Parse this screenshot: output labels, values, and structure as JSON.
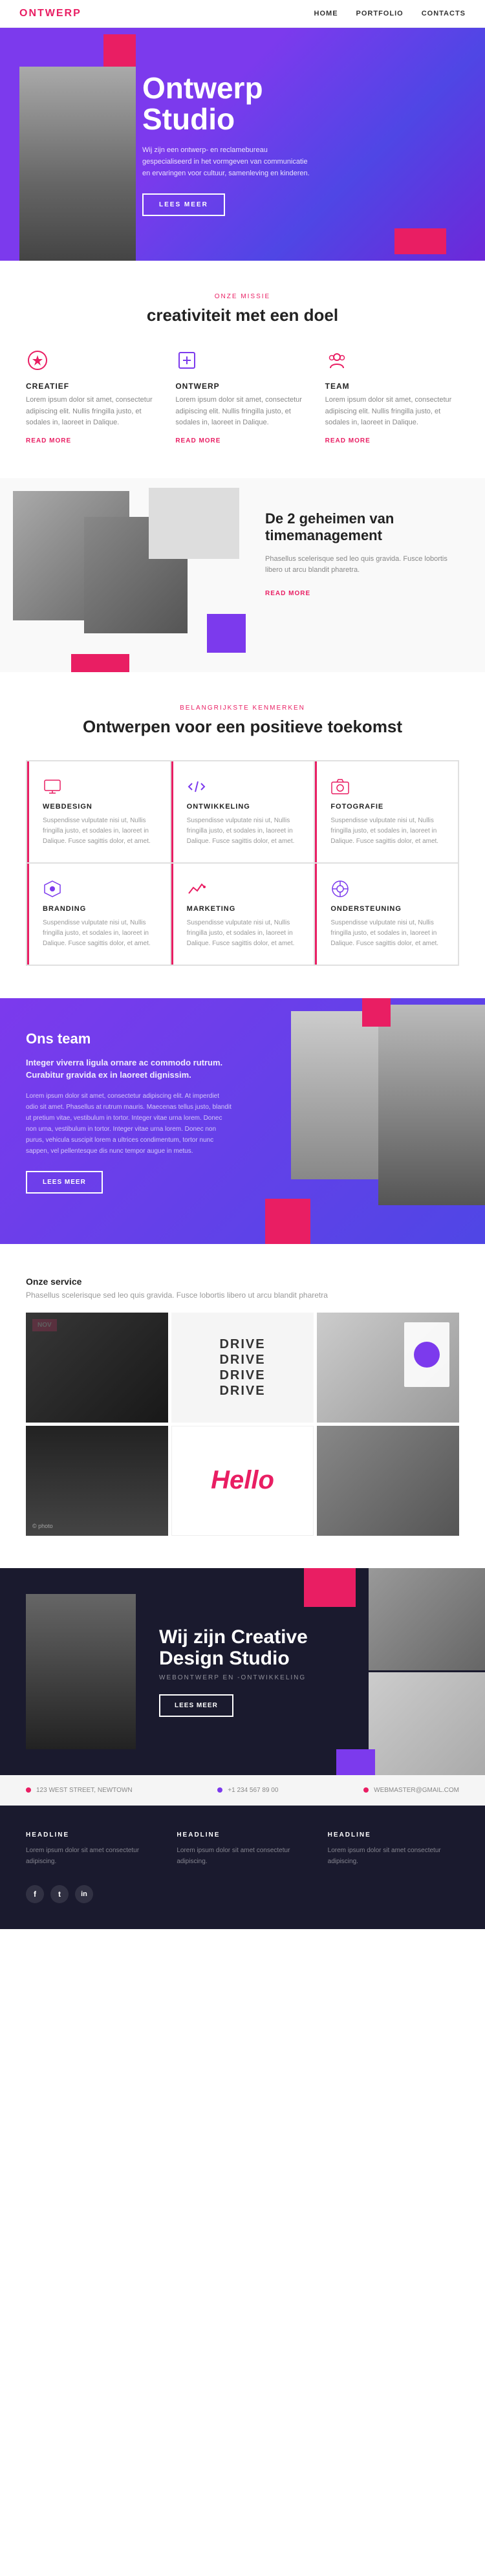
{
  "nav": {
    "logo": "ONTWERP",
    "links": [
      "HOME",
      "PORTFOLIO",
      "CONTACTS"
    ]
  },
  "hero": {
    "title": "Ontwerp\nStudio",
    "description": "Wij zijn een ontwerp- en reclamebureau gespecialiseerd in het vormgeven van communicatie en ervaringen voor cultuur, samenleving en kinderen.",
    "button": "LEES MEER"
  },
  "mission": {
    "label": "ONZE MISSIE",
    "title": "creativiteit met een doel",
    "items": [
      {
        "icon": "heart-icon",
        "title": "CREATIEF",
        "text": "Lorem ipsum dolor sit amet, consectetur adipiscing elit. Nullis fringilla justo, et sodales in, laoreet in Dalique.",
        "link": "READ MORE"
      },
      {
        "icon": "design-icon",
        "title": "ONTWERP",
        "text": "Lorem ipsum dolor sit amet, consectetur adipiscing elit. Nullis fringilla justo, et sodales in, laoreet in Dalique.",
        "link": "READ MORE"
      },
      {
        "icon": "team-icon",
        "title": "TEAM",
        "text": "Lorem ipsum dolor sit amet, consectetur adipiscing elit. Nullis fringilla justo, et sodales in, laoreet in Dalique.",
        "link": "READ MORE"
      }
    ]
  },
  "timemanagement": {
    "title": "De 2 geheimen van timemanagement",
    "text": "Phasellus scelerisque sed leo quis gravida. Fusce lobortis libero ut arcu blandit pharetra.",
    "link": "READ MORE"
  },
  "features": {
    "label": "BELANGRIJKSTE KENMERKEN",
    "title": "Ontwerpen voor een positieve toekomst",
    "items": [
      {
        "icon": "webdesign-icon",
        "title": "WEBDESIGN",
        "text": "Suspendisse vulputate nisi ut, Nullis fringilla justo, et sodales in, laoreet in Dalique. Fusce sagittis dolor, et amet."
      },
      {
        "icon": "development-icon",
        "title": "ONTWIKKELING",
        "text": "Suspendisse vulputate nisi ut, Nullis fringilla justo, et sodales in, laoreet in Dalique. Fusce sagittis dolor, et amet."
      },
      {
        "icon": "photography-icon",
        "title": "FOTOGRAFIE",
        "text": "Suspendisse vulputate nisi ut, Nullis fringilla justo, et sodales in, laoreet in Dalique. Fusce sagittis dolor, et amet."
      },
      {
        "icon": "branding-icon",
        "title": "BRANDING",
        "text": "Suspendisse vulputate nisi ut, Nullis fringilla justo, et sodales in, laoreet in Dalique. Fusce sagittis dolor, et amet."
      },
      {
        "icon": "marketing-icon",
        "title": "MARKETING",
        "text": "Suspendisse vulputate nisi ut, Nullis fringilla justo, et sodales in, laoreet in Dalique. Fusce sagittis dolor, et amet."
      },
      {
        "icon": "support-icon",
        "title": "ONDERSTEUNING",
        "text": "Suspendisse vulputate nisi ut, Nullis fringilla justo, et sodales in, laoreet in Dalique. Fusce sagittis dolor, et amet."
      }
    ]
  },
  "team": {
    "label": "Ons team",
    "title": "Integer viverra ligula ornare ac commodo rutrum. Curabitur gravida ex in laoreet dignissim.",
    "text": "Lorem ipsum dolor sit amet, consectetur adipiscing elit. At imperdiet odio sit amet. Phasellus at rutrum mauris. Maecenas tellus justo, blandit ut pretium vitae, vestibulum in tortor. Integer vitae urna lorem. Donec non urna, vestibulum in tortor. Integer vitae urna lorem. Donec non purus, vehicula suscipit lorem a ultrices condimentum, tortor nunc sappen, vel pellentesque dis nunc tempor augue in metus.",
    "button": "LEES MEER"
  },
  "services": {
    "label": "Onze service",
    "description": "Phasellus scelerisque sed leo quis gravida. Fusce lobortis libero ut arcu blandit pharetra",
    "cards": [
      {
        "type": "dark-photo",
        "date": "NOV"
      },
      {
        "type": "drive-text"
      },
      {
        "type": "badge-photo"
      },
      {
        "type": "dark-photo2"
      },
      {
        "type": "hello-text"
      },
      {
        "type": "gray-photo"
      }
    ],
    "drive_text": [
      "DRIVE",
      "DRIVE",
      "DRIVE",
      "DRIVE"
    ],
    "hello_text": "Hello"
  },
  "creative": {
    "title": "Wij zijn Creative\nDesign Studio",
    "subtitle": "WEBONTWERP EN -ONTWIKKELING",
    "button": "LEES MEER"
  },
  "contact": {
    "items": [
      {
        "label": "123 WEST STREET, NEWTOWN"
      },
      {
        "label": "+1 234 567 89 00"
      },
      {
        "label": "WEBMASTER@GMAIL.COM"
      }
    ]
  },
  "footer": {
    "columns": [
      {
        "title": "HEADLINE",
        "text": "Lorem ipsum dolor sit amet consectetur adipiscing."
      },
      {
        "title": "HEADLINE",
        "text": "Lorem ipsum dolor sit amet consectetur adipiscing."
      },
      {
        "title": "HEADLINE",
        "text": "Lorem ipsum dolor sit amet consectetur adipiscing."
      }
    ],
    "social": [
      "f",
      "t",
      "in"
    ]
  },
  "colors": {
    "primary": "#e91e63",
    "purple": "#7c3aed",
    "dark": "#1a1a2e"
  }
}
